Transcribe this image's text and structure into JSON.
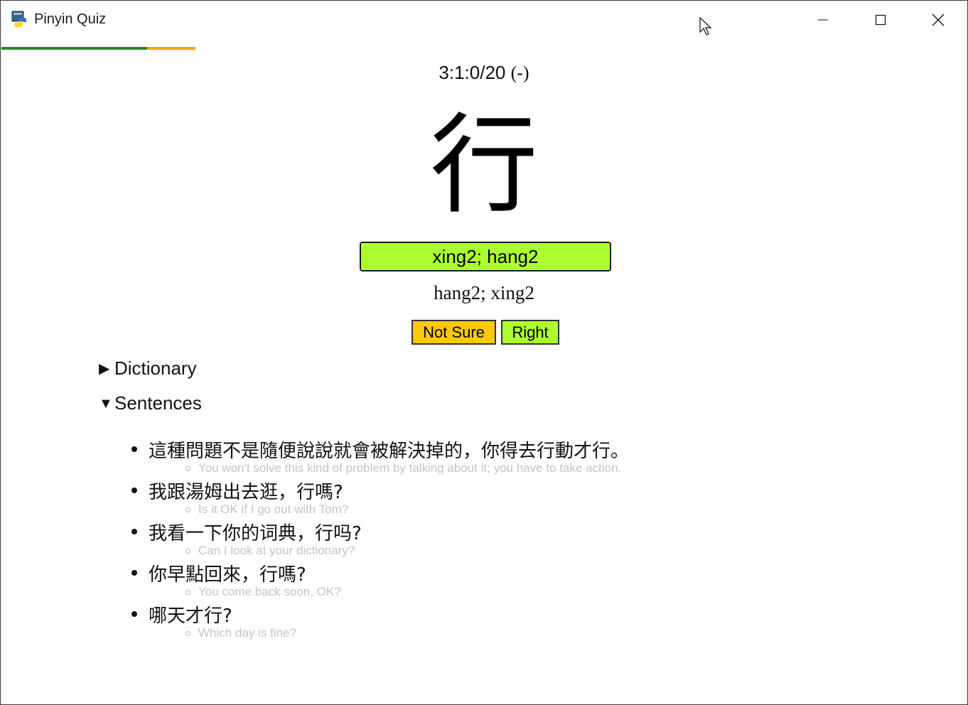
{
  "window": {
    "title": "Pinyin Quiz"
  },
  "progress": {
    "green_fraction": 0.75,
    "orange_fraction": 0.25,
    "colors": {
      "green": "#2b8a2b",
      "orange": "#f4a60d"
    }
  },
  "quiz": {
    "score": "3:1:0/20",
    "score_suffix": "(-)",
    "character": "行",
    "user_answer": "xing2; hang2",
    "correct_answer": "hang2; xing2",
    "buttons": {
      "not_sure": "Not Sure",
      "right": "Right"
    },
    "colors": {
      "answer_ok": "#adff2f",
      "not_sure": "#ffc80a"
    }
  },
  "sections": {
    "dictionary": {
      "label": "Dictionary",
      "arrow": "▶"
    },
    "sentences": {
      "label": "Sentences",
      "arrow": "▼"
    }
  },
  "sentences": [
    {
      "zh": "這種問題不是隨便說說就會被解決掉的，你得去行動才行。",
      "en": "You won't solve this kind of problem by talking about it; you have to take action."
    },
    {
      "zh": "我跟湯姆出去逛，行嗎?",
      "en": "Is it OK if I go out with Tom?"
    },
    {
      "zh": "我看一下你的词典，行吗?",
      "en": "Can I look at your dictionary?"
    },
    {
      "zh": "你早點回來，行嗎?",
      "en": "You come back soon, OK?"
    },
    {
      "zh": "哪天才行?",
      "en": "Which day is fine?"
    }
  ]
}
